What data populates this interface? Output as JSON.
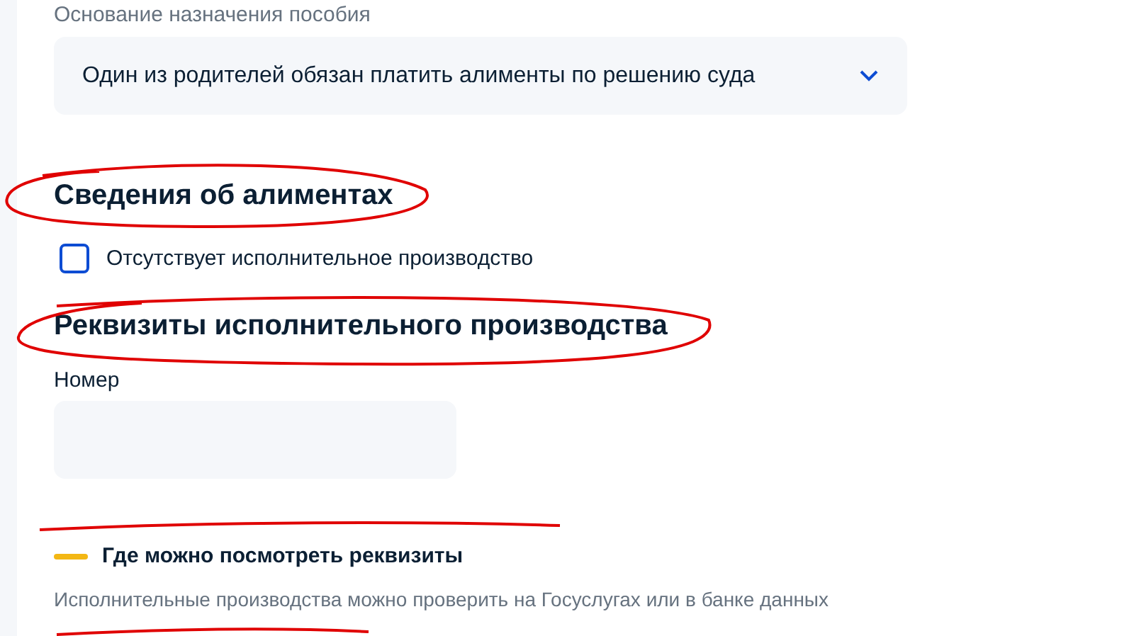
{
  "basis": {
    "label": "Основание назначения пособия",
    "value": "Один из родителей обязан платить алименты по решению суда"
  },
  "alimony": {
    "title": "Сведения об алиментах",
    "checkbox": {
      "label": "Отсутствует исполнительное производство",
      "checked": false
    }
  },
  "requisites": {
    "title": "Реквизиты исполнительного производства",
    "number_field": {
      "label": "Номер"
    }
  },
  "hint": {
    "title": "Где можно посмотреть реквизиты",
    "text": "Исполнительные производства можно проверить на Госуслугах или в банке данных"
  }
}
